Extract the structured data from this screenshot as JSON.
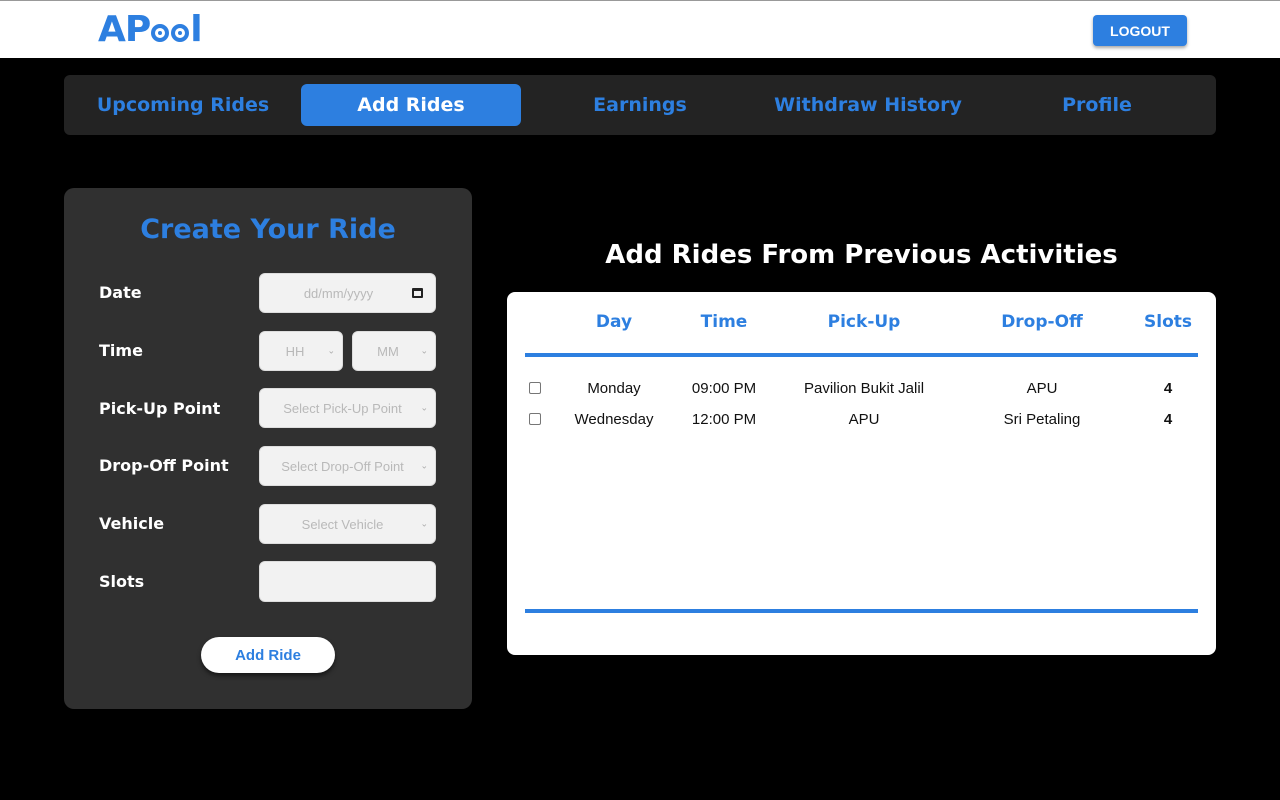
{
  "header": {
    "logo": "APool",
    "logout_label": "LOGOUT"
  },
  "nav": {
    "tabs": [
      "Upcoming Rides",
      "Add Rides",
      "Earnings",
      "Withdraw History",
      "Profile"
    ],
    "active": "Add Rides"
  },
  "create_ride": {
    "title": "Create Your Ride",
    "date_label": "Date",
    "date_placeholder": "dd/mm/yyyy",
    "time_label": "Time",
    "hour_placeholder": "HH",
    "minute_placeholder": "MM",
    "pickup_label": "Pick-Up Point",
    "pickup_placeholder": "Select Pick-Up Point",
    "dropoff_label": "Drop-Off Point",
    "dropoff_placeholder": "Select Drop-Off Point",
    "vehicle_label": "Vehicle",
    "vehicle_placeholder": "Select Vehicle",
    "slots_label": "Slots",
    "slots_value": "",
    "submit_label": "Add Ride"
  },
  "previous": {
    "title": "Add Rides From Previous Activities",
    "columns": [
      "Day",
      "Time",
      "Pick-Up",
      "Drop-Off",
      "Slots"
    ],
    "rows": [
      {
        "day": "Monday",
        "time": "09:00 PM",
        "pickup": "Pavilion Bukit Jalil",
        "dropoff": "APU",
        "slots": "4",
        "checked": false
      },
      {
        "day": "Wednesday",
        "time": "12:00 PM",
        "pickup": "APU",
        "dropoff": "Sri Petaling",
        "slots": "4",
        "checked": false
      }
    ]
  },
  "colors": {
    "accent": "#2d7fe0",
    "background": "#000000",
    "panel": "#303030",
    "navbar": "#232323"
  }
}
